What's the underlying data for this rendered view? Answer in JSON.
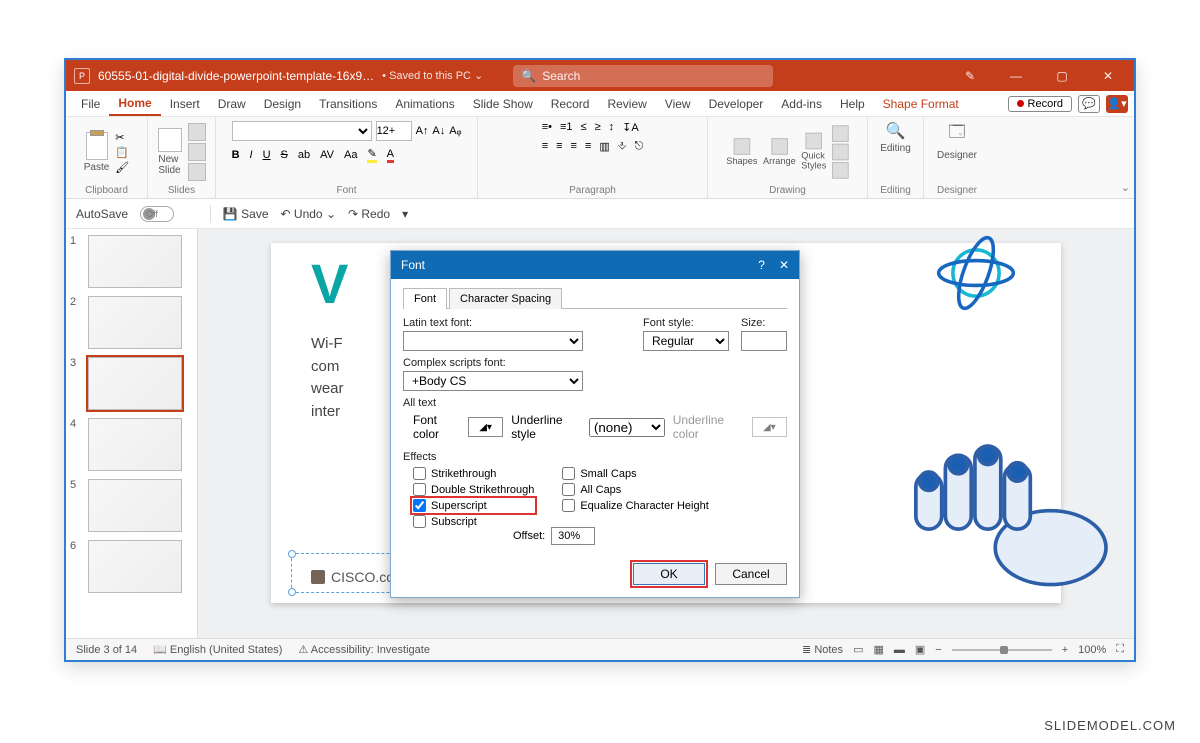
{
  "watermark": "SLIDEMODEL.COM",
  "titlebar": {
    "filename": "60555-01-digital-divide-powerpoint-template-16x9…",
    "saved": "• Saved to this PC ⌄",
    "search_placeholder": "Search"
  },
  "menus": [
    "File",
    "Home",
    "Insert",
    "Draw",
    "Design",
    "Transitions",
    "Animations",
    "Slide Show",
    "Record",
    "Review",
    "View",
    "Developer",
    "Add-ins",
    "Help",
    "Shape Format"
  ],
  "active_menu": "Home",
  "record_label": "Record",
  "ribbon": {
    "groups": [
      "Clipboard",
      "Slides",
      "Font",
      "Paragraph",
      "Drawing",
      "Editing",
      "Designer"
    ],
    "paste": "Paste",
    "newslide": "New\nSlide",
    "font_size": "12+",
    "shapes": "Shapes",
    "arrange": "Arrange",
    "quickstyles": "Quick\nStyles",
    "editing": "Editing",
    "designer": "Designer"
  },
  "qat": {
    "autosave": "AutoSave",
    "autosave_state": "Off",
    "save": "Save",
    "undo": "Undo",
    "redo": "Redo"
  },
  "thumbs": [
    "1",
    "2",
    "3",
    "4",
    "5",
    "6"
  ],
  "selected_thumb": "3",
  "slide": {
    "body_lines": [
      "Wi-F",
      "com",
      "wear",
      "inter"
    ],
    "citation": "CISCO.com, What Is Wi-Fi?"
  },
  "status": {
    "slide_of": "Slide 3 of 14",
    "lang": "English (United States)",
    "access": "Accessibility: Investigate",
    "notes": "Notes",
    "zoom": "100%"
  },
  "dialog": {
    "title": "Font",
    "tabs": [
      "Font",
      "Character Spacing"
    ],
    "active_tab": "Font",
    "latin_label": "Latin text font:",
    "latin_value": "",
    "fontstyle_label": "Font style:",
    "fontstyle_value": "Regular",
    "size_label": "Size:",
    "size_value": "",
    "complex_label": "Complex scripts font:",
    "complex_value": "+Body CS",
    "alltext": "All text",
    "fontcolor_label": "Font color",
    "underlinestyle_label": "Underline style",
    "underlinestyle_value": "(none)",
    "underlinecolor_label": "Underline color",
    "effects_label": "Effects",
    "strikethrough": "Strikethrough",
    "double_strike": "Double Strikethrough",
    "superscript": "Superscript",
    "subscript": "Subscript",
    "smallcaps": "Small Caps",
    "allcaps": "All Caps",
    "equalize": "Equalize Character Height",
    "offset_label": "Offset:",
    "offset_value": "30%",
    "ok": "OK",
    "cancel": "Cancel"
  }
}
